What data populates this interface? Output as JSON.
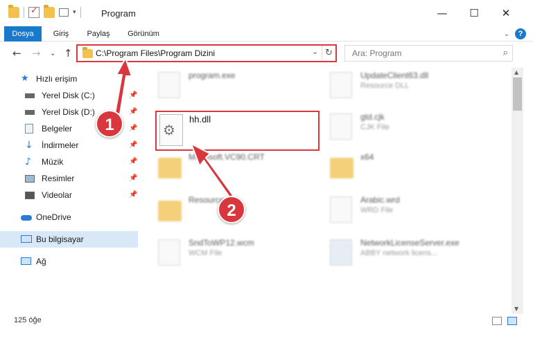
{
  "window": {
    "title": "Program",
    "controls": [
      "minimize-icon",
      "maximize-icon",
      "close-icon"
    ]
  },
  "ribbon": {
    "tabs": [
      "Dosya",
      "Giriş",
      "Paylaş",
      "Görünüm"
    ],
    "file_tab_color": "#1979ca"
  },
  "address": {
    "path": "C:\\Program Files\\Program Dizini"
  },
  "search": {
    "placeholder": "Ara: Program"
  },
  "nav": {
    "quick_access": "Hızlı erişim",
    "items": [
      {
        "label": "Yerel Disk (C:)",
        "icon": "drive-icon",
        "pinned": true
      },
      {
        "label": "Yerel Disk (D:)",
        "icon": "drive-icon",
        "pinned": true
      },
      {
        "label": "Belgeler",
        "icon": "documents-icon",
        "pinned": true
      },
      {
        "label": "İndirmeler",
        "icon": "download-icon",
        "pinned": true
      },
      {
        "label": "Müzik",
        "icon": "music-icon",
        "pinned": true
      },
      {
        "label": "Resimler",
        "icon": "pictures-icon",
        "pinned": true
      },
      {
        "label": "Videolar",
        "icon": "videos-icon",
        "pinned": true
      }
    ],
    "onedrive": "OneDrive",
    "this_pc": "Bu bilgisayar",
    "network": "Ağ"
  },
  "files": {
    "left": [
      {
        "name": "program.exe",
        "type": ""
      },
      {
        "name": "hh.dll",
        "type": ""
      },
      {
        "name": "Microsoft.VC90.CRT",
        "type": ""
      },
      {
        "name": "Resources",
        "type": ""
      },
      {
        "name": "SndToWP12.wcm",
        "type": "WCM File"
      }
    ],
    "right": [
      {
        "name": "UpdateClient63.dll",
        "type": "Resource DLL"
      },
      {
        "name": "gtd.cjk",
        "type": "CJK File"
      },
      {
        "name": "x64",
        "type": ""
      },
      {
        "name": "Arabic.wrd",
        "type": "WRD File"
      },
      {
        "name": "NetworkLicenseServer.exe",
        "type": "ABBY network licens..."
      }
    ]
  },
  "status": {
    "count": "125 öğe"
  },
  "callouts": [
    "1",
    "2"
  ],
  "colors": {
    "highlight": "#d9363e",
    "selected_nav": "#d9e8f7"
  }
}
